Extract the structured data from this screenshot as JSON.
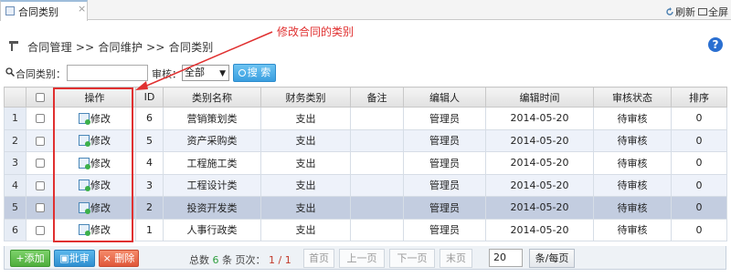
{
  "tab": {
    "label": "合同类别",
    "close": "×"
  },
  "toolbar": {
    "refresh": "刷新",
    "fullscreen": "全屏"
  },
  "breadcrumb": "合同管理 >> 合同维护 >> 合同类别",
  "help": "?",
  "search": {
    "label": "合同类别：",
    "value": "",
    "audit_label": "审核：",
    "audit_value": "全部",
    "button": "搜 索"
  },
  "columns": [
    "操作",
    "ID",
    "类别名称",
    "财务类别",
    "备注",
    "编辑人",
    "编辑时间",
    "审核状态",
    "排序"
  ],
  "rows": [
    {
      "rn": "1",
      "op": "修改",
      "id": "6",
      "name": "营销策划类",
      "finance": "支出",
      "remark": "",
      "editor": "管理员",
      "time": "2014-05-20",
      "status": "待审核",
      "sort": "0"
    },
    {
      "rn": "2",
      "op": "修改",
      "id": "5",
      "name": "资产采购类",
      "finance": "支出",
      "remark": "",
      "editor": "管理员",
      "time": "2014-05-20",
      "status": "待审核",
      "sort": "0"
    },
    {
      "rn": "3",
      "op": "修改",
      "id": "4",
      "name": "工程施工类",
      "finance": "支出",
      "remark": "",
      "editor": "管理员",
      "time": "2014-05-20",
      "status": "待审核",
      "sort": "0"
    },
    {
      "rn": "4",
      "op": "修改",
      "id": "3",
      "name": "工程设计类",
      "finance": "支出",
      "remark": "",
      "editor": "管理员",
      "time": "2014-05-20",
      "status": "待审核",
      "sort": "0"
    },
    {
      "rn": "5",
      "op": "修改",
      "id": "2",
      "name": "投资开发类",
      "finance": "支出",
      "remark": "",
      "editor": "管理员",
      "time": "2014-05-20",
      "status": "待审核",
      "sort": "0"
    },
    {
      "rn": "6",
      "op": "修改",
      "id": "1",
      "name": "人事行政类",
      "finance": "支出",
      "remark": "",
      "editor": "管理员",
      "time": "2014-05-20",
      "status": "待审核",
      "sort": "0"
    }
  ],
  "bottom": {
    "add": "+添加",
    "audit": "批审",
    "delete": "× 删除",
    "total_prefix": "总数",
    "total": "6",
    "total_mid": "条 页次：",
    "page": "1 / 1",
    "first": "首页",
    "prev": "上一页",
    "next": "下一页",
    "last": "末页",
    "page_size": "20",
    "page_size_btn": "条/每页"
  },
  "annotation": "修改合同的类别",
  "colors": {
    "annotation": "#e03030",
    "selected_row": "#c3cde0",
    "finance_link": "#1a3cc8"
  }
}
